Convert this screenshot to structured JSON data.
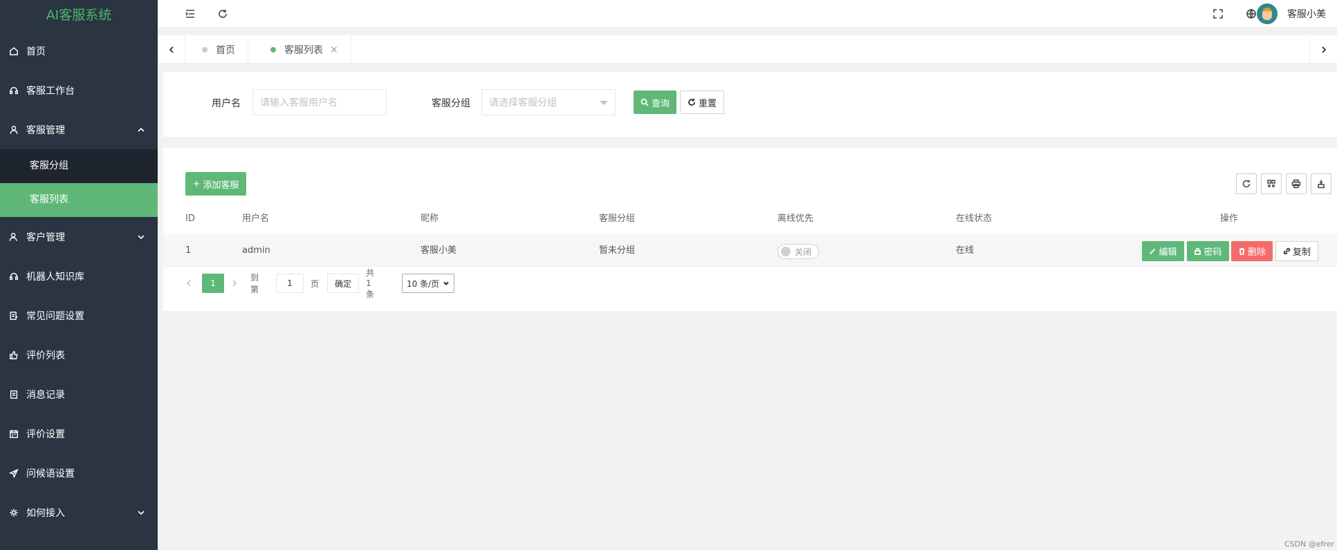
{
  "app": {
    "title": "AI客服系统"
  },
  "sidebar": {
    "items": [
      {
        "label": "首页",
        "icon": "home-icon"
      },
      {
        "label": "客服工作台",
        "icon": "headset-icon"
      },
      {
        "label": "客服管理",
        "icon": "user-icon",
        "expanded": true,
        "children": [
          {
            "label": "客服分组"
          },
          {
            "label": "客服列表",
            "active": true
          }
        ]
      },
      {
        "label": "客户管理",
        "icon": "customer-icon"
      },
      {
        "label": "机器人知识库",
        "icon": "robot-icon"
      },
      {
        "label": "常见问题设置",
        "icon": "faq-icon"
      },
      {
        "label": "评价列表",
        "icon": "thumb-up-icon"
      },
      {
        "label": "消息记录",
        "icon": "message-log-icon"
      },
      {
        "label": "评价设置",
        "icon": "calendar-icon"
      },
      {
        "label": "问候语设置",
        "icon": "send-icon"
      },
      {
        "label": "如何接入",
        "icon": "plugin-icon"
      }
    ]
  },
  "header": {
    "username": "客服小美"
  },
  "tabs": [
    {
      "label": "首页"
    },
    {
      "label": "客服列表",
      "active": true,
      "close": "×"
    }
  ],
  "search": {
    "username_label": "用户名",
    "username_placeholder": "请输入客服用户名",
    "group_label": "客服分组",
    "group_placeholder": "请选择客服分组",
    "query_label": "查询",
    "reset_label": "重置"
  },
  "toolbar": {
    "add_label": "添加客服"
  },
  "table": {
    "columns": [
      "ID",
      "用户名",
      "昵称",
      "客服分组",
      "离线优先",
      "在线状态",
      "操作"
    ],
    "rows": [
      {
        "id": "1",
        "username": "admin",
        "nickname": "客服小美",
        "group": "暂未分组",
        "offline_first": "关闭",
        "status": "在线"
      }
    ],
    "actions": {
      "edit": "编辑",
      "password": "密码",
      "delete": "删除",
      "copy": "复制"
    }
  },
  "pagination": {
    "current": "1",
    "goto_label": "到第",
    "goto_value": "1",
    "page_unit": "页",
    "confirm": "确定",
    "total": "共 1 条",
    "page_size": "10 条/页"
  },
  "watermark": "CSDN @efrer",
  "colors": {
    "accent": "#5fb878",
    "sidebar_bg": "#2a3541",
    "danger": "#f56b6b",
    "logo": "#4fb56c"
  }
}
